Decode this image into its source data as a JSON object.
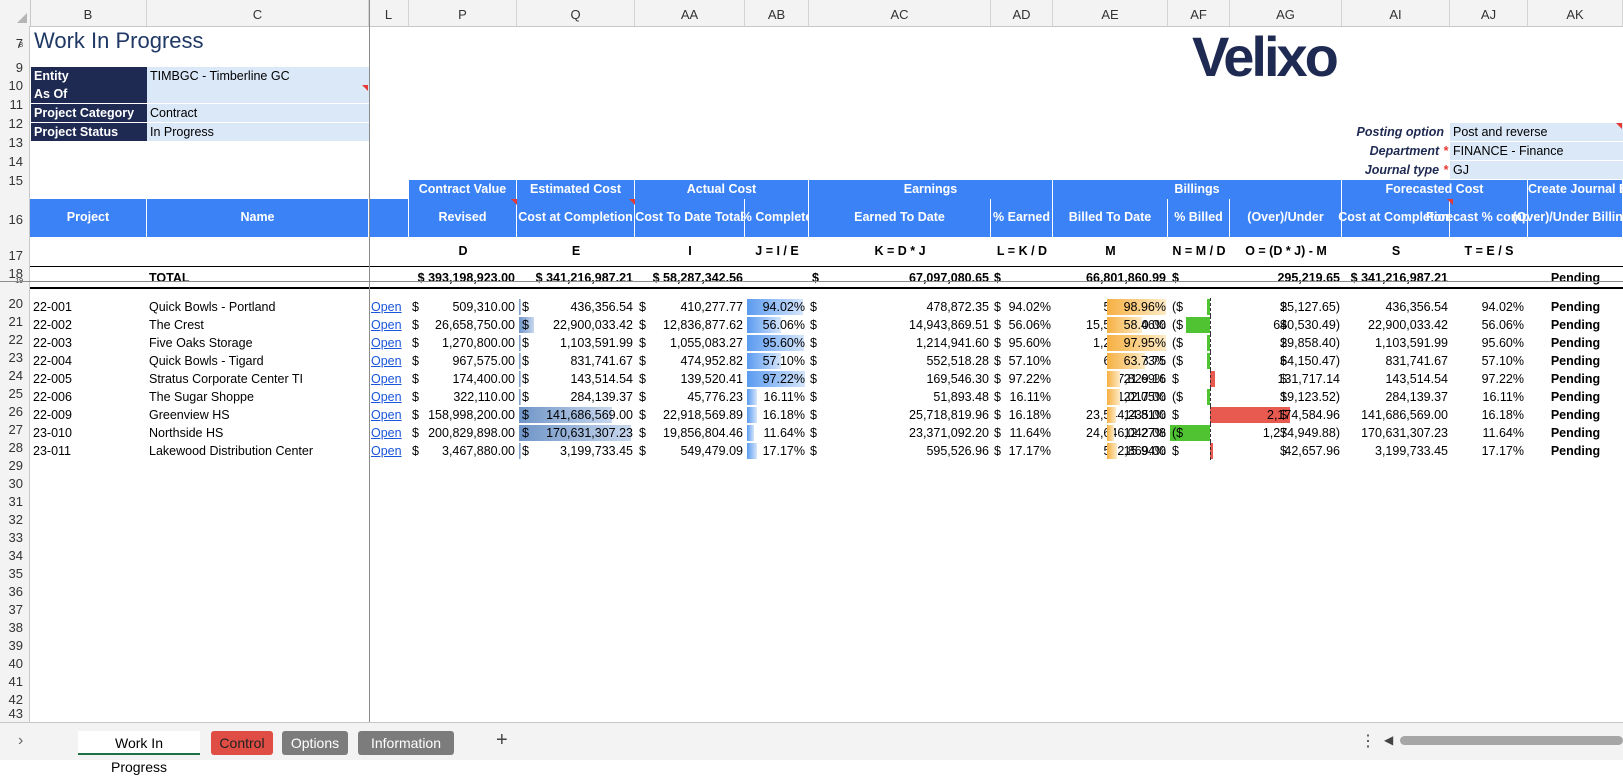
{
  "column_headers": [
    "B",
    "C",
    "L",
    "P",
    "Q",
    "AA",
    "AB",
    "AC",
    "AD",
    "AE",
    "AF",
    "AG",
    "AI",
    "AJ",
    "AK"
  ],
  "row_numbers": [
    "7",
    "8",
    "9",
    "10",
    "11",
    "12",
    "13",
    "14",
    "15",
    "16",
    "17",
    "18",
    "19",
    "20",
    "21",
    "22",
    "23",
    "24",
    "25",
    "26",
    "27",
    "28",
    "29",
    "30",
    "31",
    "32",
    "33",
    "34",
    "35",
    "36",
    "37",
    "38",
    "39",
    "40",
    "41",
    "42",
    "43"
  ],
  "title": "Work In Progress",
  "logo": "Velixo",
  "filters": [
    {
      "label": "Entity",
      "value": "TIMBGC - Timberline GC"
    },
    {
      "label": "As Of",
      "value": ""
    },
    {
      "label": "Project Category",
      "value": "Contract"
    },
    {
      "label": "Project Status",
      "value": "In Progress"
    }
  ],
  "posting": [
    {
      "label": "Posting option",
      "value": "Post and reverse",
      "required": ""
    },
    {
      "label": "Department",
      "value": "FINANCE - Finance",
      "required": "*"
    },
    {
      "label": "Journal type",
      "value": "GJ",
      "required": "*"
    }
  ],
  "groups": [
    "Contract Value",
    "Estimated Cost",
    "Actual Cost",
    "Earnings",
    "Billings",
    "Forecasted Cost",
    "Create Journal Entry"
  ],
  "headers": [
    "Project",
    "Name",
    "Revised",
    "Cost at Completion",
    "Cost To Date Total",
    "% Complete",
    "Earned To Date",
    "% Earned",
    "Billed To Date",
    "% Billed",
    "(Over)/Under",
    "Cost at Completion",
    "Forecast % complete",
    "(Over)/Under Billings"
  ],
  "formulas": [
    "D",
    "E",
    "I",
    "J = I / E",
    "K = D * J",
    "L = K / D",
    "M",
    "N = M / D",
    "O = (D * J) - M",
    "S",
    "T = E / S"
  ],
  "total": {
    "label": "TOTAL",
    "revised": "$ 393,198,923.00",
    "est_cost": "$ 341,216,987.21",
    "actual": "$ 58,287,342.56",
    "earned_cur": "$",
    "earned": "67,097,080.65",
    "billed_cur": "$",
    "billed": "66,801,860.99",
    "ou_cur": "$",
    "ou": "295,219.65",
    "forecast": "$ 341,216,987.21",
    "je": "Pending"
  },
  "rows": [
    {
      "project": "22-001",
      "name": "Quick Bowls - Portland",
      "link": "Open",
      "revised": "509,310.00",
      "est": "436,356.54",
      "actual": "410,277.77",
      "pct": "94.02%",
      "pct_val": 94.02,
      "earned": "478,872.35",
      "pct_earned": "94.02%",
      "billed": "504,000.00",
      "pct_billed": "98.96%",
      "pct_billed_val": 98.96,
      "ou_open": "($",
      "ou": "25,127.65)",
      "ou_val": -25127.65,
      "forecast": "436,356.54",
      "fpct": "94.02%",
      "je": "Pending"
    },
    {
      "project": "22-002",
      "name": "The Crest",
      "link": "Open",
      "revised": "26,658,750.00",
      "est": "22,900,033.42",
      "actual": "12,836,877.62",
      "pct": "56.06%",
      "pct_val": 56.06,
      "earned": "14,943,869.51",
      "pct_earned": "56.06%",
      "billed": "15,584,400.00",
      "pct_billed": "58.46%",
      "pct_billed_val": 58.46,
      "ou_open": "($",
      "ou": "640,530.49)",
      "ou_val": -640530.49,
      "forecast": "22,900,033.42",
      "fpct": "56.06%",
      "je": "Pending"
    },
    {
      "project": "22-003",
      "name": "Five Oaks Storage",
      "link": "Open",
      "revised": "1,270,800.00",
      "est": "1,103,591.99",
      "actual": "1,055,083.27",
      "pct": "95.60%",
      "pct_val": 95.6,
      "earned": "1,214,941.60",
      "pct_earned": "95.60%",
      "billed": "1,244,800.00",
      "pct_billed": "97.95%",
      "pct_billed_val": 97.95,
      "ou_open": "($",
      "ou": "29,858.40)",
      "ou_val": -29858.4,
      "forecast": "1,103,591.99",
      "fpct": "95.60%",
      "je": "Pending"
    },
    {
      "project": "22-004",
      "name": "Quick Bowls - Tigard",
      "link": "Open",
      "revised": "967,575.00",
      "est": "831,741.67",
      "actual": "474,952.82",
      "pct": "57.10%",
      "pct_val": 57.1,
      "earned": "552,518.28",
      "pct_earned": "57.10%",
      "billed": "616,668.75",
      "pct_billed": "63.73%",
      "pct_billed_val": 63.73,
      "ou_open": "($",
      "ou": "64,150.47)",
      "ou_val": -64150.47,
      "forecast": "831,741.67",
      "fpct": "57.10%",
      "je": "Pending"
    },
    {
      "project": "22-005",
      "name": "Stratus Corporate Center TI",
      "link": "Open",
      "revised": "174,400.00",
      "est": "143,514.54",
      "actual": "139,520.41",
      "pct": "97.22%",
      "pct_val": 97.22,
      "earned": "169,546.30",
      "pct_earned": "97.22%",
      "billed": "37,829.16",
      "pct_billed": "21.69%",
      "pct_billed_val": 21.69,
      "ou_open": "$",
      "ou": "131,717.14",
      "ou_val": 131717.14,
      "forecast": "143,514.54",
      "fpct": "97.22%",
      "je": "Pending"
    },
    {
      "project": "22-006",
      "name": "The Sugar Shoppe",
      "link": "Open",
      "revised": "322,110.00",
      "est": "284,139.37",
      "actual": "45,776.23",
      "pct": "16.11%",
      "pct_val": 16.11,
      "earned": "51,893.48",
      "pct_earned": "16.11%",
      "billed": "71,017.00",
      "pct_billed": "22.05%",
      "pct_billed_val": 22.05,
      "ou_open": "($",
      "ou": "19,123.52)",
      "ou_val": -19123.52,
      "forecast": "284,139.37",
      "fpct": "16.11%",
      "je": "Pending"
    },
    {
      "project": "22-009",
      "name": "Greenview HS",
      "link": "Open",
      "revised": "158,998,200.00",
      "est": "141,686,569.00",
      "actual": "22,918,569.89",
      "pct": "16.18%",
      "pct_val": 16.18,
      "earned": "25,718,819.96",
      "pct_earned": "16.18%",
      "billed": "23,544,235.00",
      "pct_billed": "14.81%",
      "pct_billed_val": 14.81,
      "ou_open": "$",
      "ou": "2,174,584.96",
      "ou_val": 2174584.96,
      "forecast": "141,686,569.00",
      "fpct": "16.18%",
      "je": "Pending"
    },
    {
      "project": "23-010",
      "name": "Northside HS",
      "link": "Open",
      "revised": "200,829,898.00",
      "est": "170,631,307.23",
      "actual": "19,856,804.46",
      "pct": "11.64%",
      "pct_val": 11.64,
      "earned": "23,371,092.20",
      "pct_earned": "11.64%",
      "billed": "24,646,042.08",
      "pct_billed": "12.27%",
      "pct_billed_val": 12.27,
      "ou_open": "($",
      "ou": "1,274,949.88)",
      "ou_val": -1274949.88,
      "forecast": "170,631,307.23",
      "fpct": "11.64%",
      "je": "Pending"
    },
    {
      "project": "23-011",
      "name": "Lakewood Distribution Center",
      "link": "Open",
      "revised": "3,467,880.00",
      "est": "3,199,733.45",
      "actual": "549,479.09",
      "pct": "17.17%",
      "pct_val": 17.17,
      "earned": "595,526.96",
      "pct_earned": "17.17%",
      "billed": "552,869.00",
      "pct_billed": "15.94%",
      "pct_billed_val": 15.94,
      "ou_open": "$",
      "ou": "42,657.96",
      "ou_val": 42657.96,
      "forecast": "3,199,733.45",
      "fpct": "17.17%",
      "je": "Pending"
    }
  ],
  "tabs": [
    {
      "label": "Work In Progress",
      "style": "active"
    },
    {
      "label": "Control",
      "style": "red"
    },
    {
      "label": "Options",
      "style": "gray"
    },
    {
      "label": "Information",
      "style": "gray"
    }
  ],
  "add_sheet_symbol": "+",
  "colors": {
    "header_blue": "#3b82f6",
    "label_navy": "#1f2a52",
    "value_bg": "#dbe8f8",
    "bar_blue": "#5b9bf0",
    "bar_orange": "#f6b042",
    "neg_green": "#4fc332",
    "pos_red": "#e8594f"
  }
}
